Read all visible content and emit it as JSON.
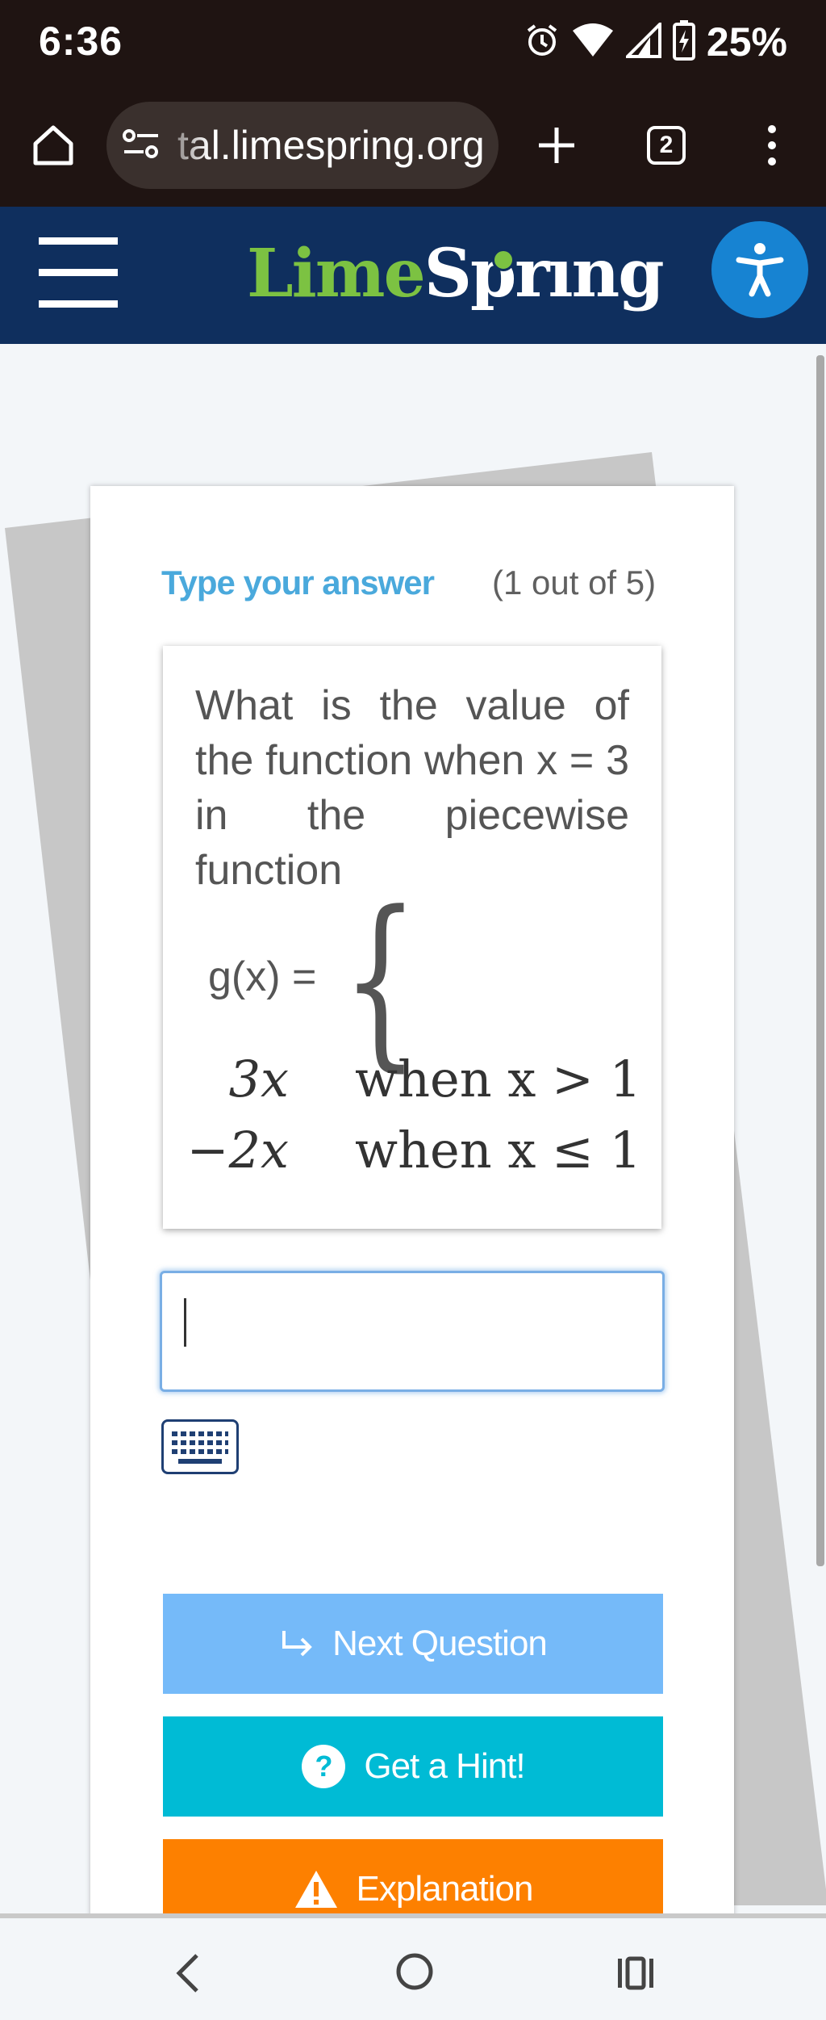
{
  "status_bar": {
    "time": "6:36",
    "battery": "25%",
    "icons": [
      "alarm-icon",
      "wifi-icon",
      "signal-icon",
      "battery-charging-icon"
    ]
  },
  "browser": {
    "url": "tal.limespring.org",
    "tab_count": "2"
  },
  "header": {
    "logo_part1": "Lime",
    "logo_part2": "Spr",
    "logo_part3": "ng"
  },
  "quiz": {
    "prompt_label": "Type your answer",
    "progress": "(1 out of 5)",
    "question": "What is the value of the function when x = 3 in the piecewise function",
    "equation_lhs": "g(x) =",
    "cases": [
      {
        "expr": "3x",
        "condition": "when x > 1"
      },
      {
        "expr": "−2x",
        "condition": "when x ≤ 1"
      }
    ],
    "answer_value": ""
  },
  "buttons": {
    "next": "Next Question",
    "hint": "Get a Hint!",
    "explanation": "Explanation"
  },
  "colors": {
    "header_bg": "#0f2f5e",
    "lime_green": "#7cc242",
    "next_btn": "#75baf9",
    "hint_btn": "#00bbd5",
    "explain_btn": "#fd8000",
    "label_blue": "#4aa9dc"
  }
}
